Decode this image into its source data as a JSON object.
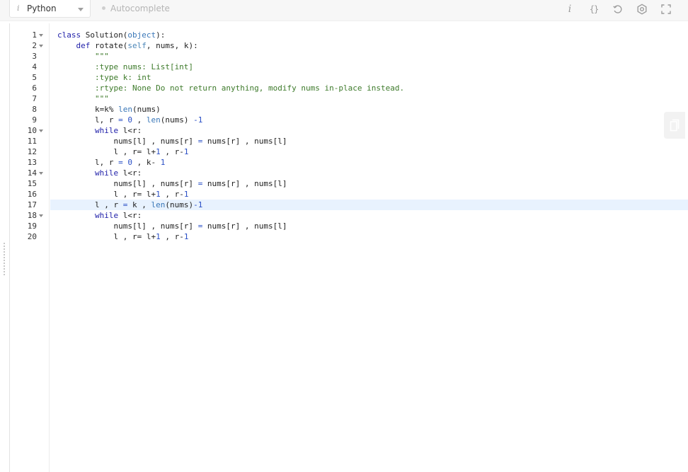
{
  "toolbar": {
    "language": "Python",
    "info_glyph": "i",
    "autocomplete_label": "Autocomplete",
    "icons": [
      "info-icon",
      "braces-icon",
      "reset-icon",
      "settings-icon",
      "fullscreen-icon"
    ],
    "braces_glyph": "{}"
  },
  "editor": {
    "active_line": 17,
    "line_numbers": [
      "1",
      "2",
      "3",
      "4",
      "5",
      "6",
      "7",
      "8",
      "9",
      "10",
      "11",
      "12",
      "13",
      "14",
      "15",
      "16",
      "17",
      "18",
      "19",
      "20"
    ],
    "foldable_lines": [
      1,
      2,
      10,
      14,
      18
    ],
    "code_lines": [
      "class Solution(object):",
      "    def rotate(self, nums, k):",
      "        \"\"\"",
      "        :type nums: List[int]",
      "        :type k: int",
      "        :rtype: None Do not return anything, modify nums in-place instead.",
      "        \"\"\"",
      "        k=k% len(nums)",
      "        l, r = 0 , len(nums) -1",
      "        while l<r:",
      "            nums[l] , nums[r] = nums[r] , nums[l]",
      "            l , r= l+1 , r-1",
      "        l, r = 0 , k- 1",
      "        while l<r:",
      "            nums[l] , nums[r] = nums[r] , nums[l]",
      "            l , r= l+1 , r-1",
      "        l , r = k , len(nums)-1",
      "        while l<r:",
      "            nums[l] , nums[r] = nums[r] , nums[l]",
      "            l , r= l+1 , r-1"
    ]
  },
  "colors": {
    "keyword": "#1e1ea8",
    "builtin": "#3a77b8",
    "number": "#2a4fc6",
    "string": "#3d7a2a",
    "active_line_bg": "#e8f2fe"
  }
}
